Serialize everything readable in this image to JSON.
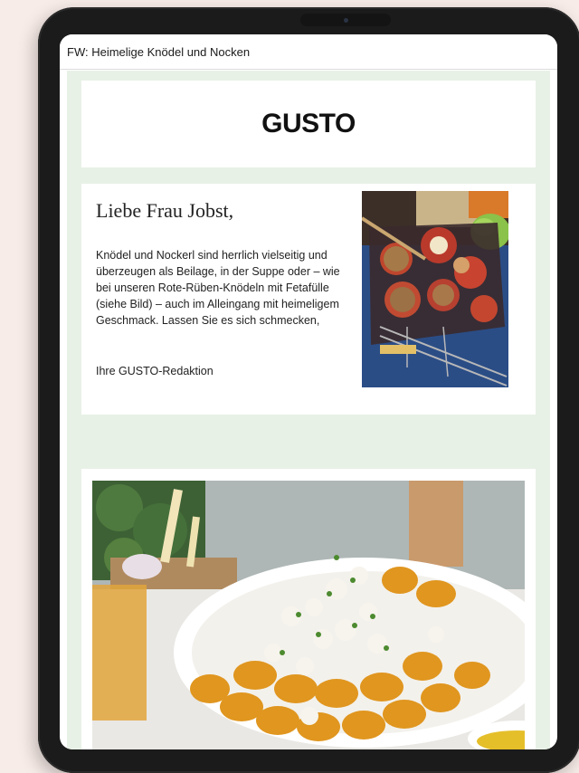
{
  "email": {
    "subject": "FW: Heimelige Knödel und Nocken",
    "brand": "GUSTO",
    "greeting": "Liebe Frau Jobst,",
    "intro": "Knödel und Nockerl sind herrlich vielseitig und überzeugen als Beilage, in der Suppe oder – wie bei unseren Rote-Rüben-Knödeln mit Fetafülle (siehe Bild) – auch im Alleingang mit heimeligem Geschmack. Lassen Sie es sich schmecken,",
    "signoff": "Ihre GUSTO-Redaktion"
  },
  "colors": {
    "page_bg": "#f8ece8",
    "mail_bg": "#e8f1e6",
    "device_frame": "#1b1b1b"
  },
  "images": {
    "intro_photo": "beetroot-dumplings-with-feta-filling-photo",
    "recipe_photo": "golden-nocken-with-herb-feta-topping-photo"
  }
}
